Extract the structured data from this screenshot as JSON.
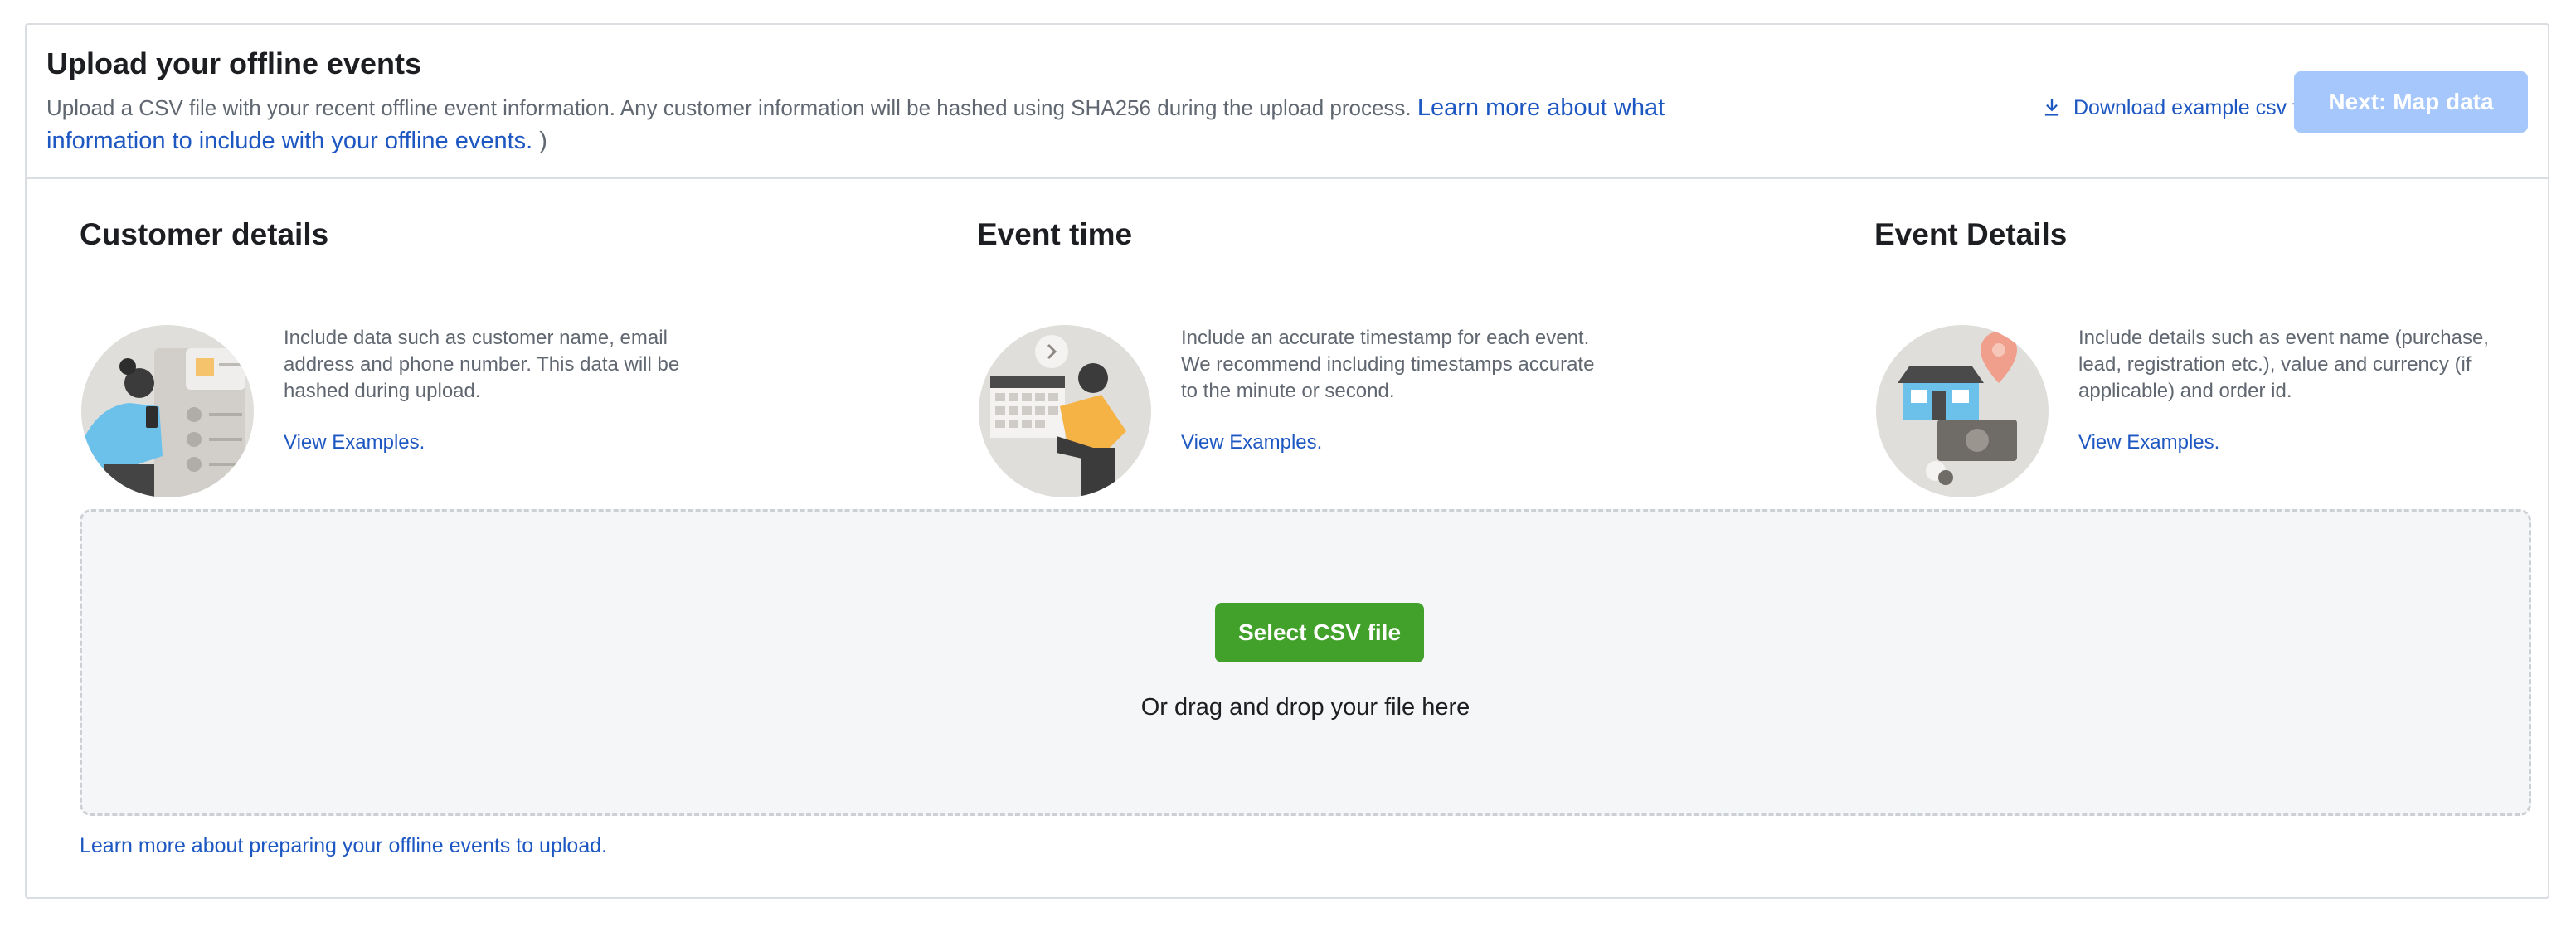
{
  "header": {
    "title": "Upload your offline events",
    "description": "Upload a CSV file with your recent offline event information. Any customer information will be hashed using SHA256 during the upload process. ",
    "learn_more_link": "Learn more about what information to include with your offline events.",
    "description_tail": " )",
    "download_label": "Download example csv file",
    "next_label": "Next: Map data"
  },
  "sections": [
    {
      "title": "Customer details",
      "text": "Include data such as customer name, email address and phone number. This data will be hashed during upload.",
      "link": "View Examples.",
      "icon": "person-with-phone-illustration"
    },
    {
      "title": "Event time",
      "text": "Include an accurate timestamp for each event. We recommend including timestamps accurate to the minute or second.",
      "link": "View Examples.",
      "icon": "calendar-clock-illustration"
    },
    {
      "title": "Event Details",
      "text": "Include details such as event name (purchase, lead, registration etc.), value and currency (if applicable) and order id.",
      "link": "View Examples.",
      "icon": "store-location-money-illustration"
    }
  ],
  "dropzone": {
    "button_label": "Select CSV file",
    "drag_text": "Or drag and drop your file here"
  },
  "footer": {
    "link": "Learn more about preparing your offline events to upload."
  },
  "colors": {
    "link": "#1d57c2",
    "primary_disabled": "#a5c7fb",
    "select_button": "#42a12b",
    "dropzone_bg": "#f5f6f7"
  }
}
